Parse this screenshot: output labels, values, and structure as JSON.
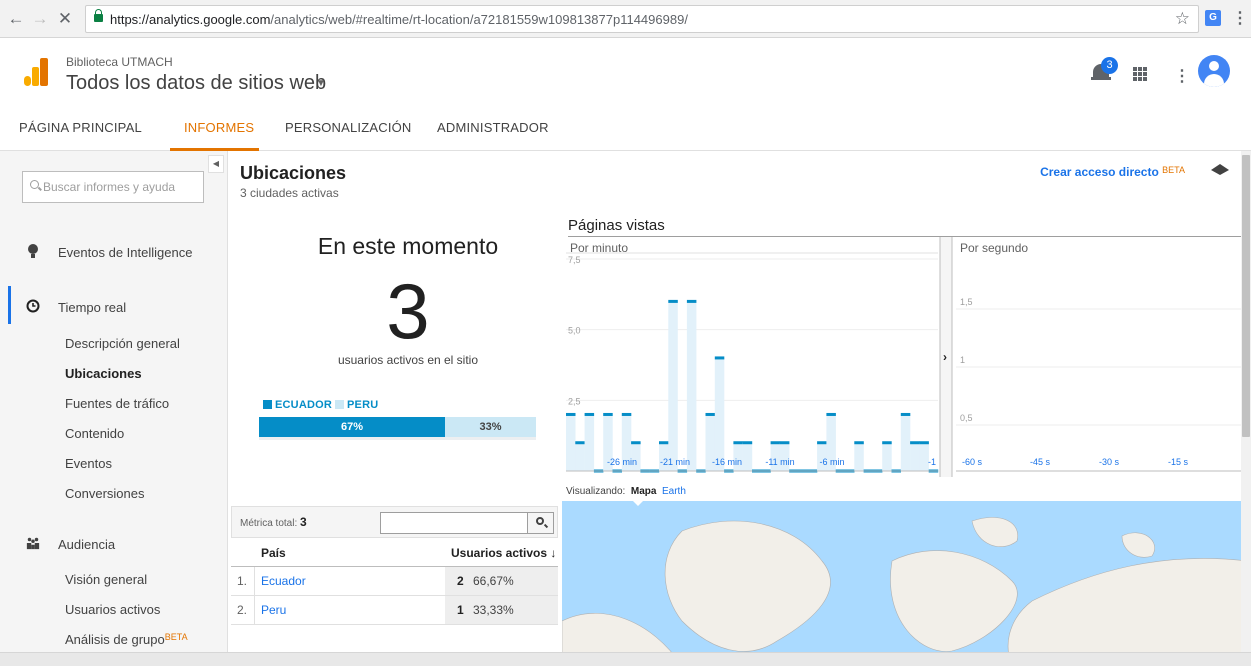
{
  "browser": {
    "url_host": "https://analytics.google.com",
    "url_path": "/analytics/web/#realtime/rt-location/a72181559w109813877p114496989/"
  },
  "header": {
    "account": "Biblioteca UTMACH",
    "property": "Todos los datos de sitios web",
    "notifications_count": "3"
  },
  "tabs": [
    {
      "label": "PÁGINA PRINCIPAL"
    },
    {
      "label": "INFORMES"
    },
    {
      "label": "PERSONALIZACIÓN"
    },
    {
      "label": "ADMINISTRADOR"
    }
  ],
  "sidebar": {
    "search_placeholder": "Buscar informes y ayuda",
    "intelligence": "Eventos de Intelligence",
    "realtime": "Tiempo real",
    "realtime_items": [
      {
        "label": "Descripción general"
      },
      {
        "label": "Ubicaciones"
      },
      {
        "label": "Fuentes de tráfico"
      },
      {
        "label": "Contenido"
      },
      {
        "label": "Eventos"
      },
      {
        "label": "Conversiones"
      }
    ],
    "audience": "Audiencia",
    "audience_items": [
      {
        "label": "Visión general"
      },
      {
        "label": "Usuarios activos"
      },
      {
        "label": "Análisis de grupo"
      }
    ],
    "beta": "BETA"
  },
  "main": {
    "title": "Ubicaciones",
    "subtitle": "3 ciudades activas",
    "shortcut": "Crear acceso directo",
    "shortcut_beta": "BETA",
    "now_label": "En este momento",
    "now_value": "3",
    "now_desc": "usuarios activos en el sitio",
    "split": [
      {
        "name": "ECUADOR",
        "pct": 67,
        "label": "67%",
        "color": "#058dc7"
      },
      {
        "name": "PERU",
        "pct": 33,
        "label": "33%",
        "color": "#cbe8f5"
      }
    ],
    "table": {
      "metric_total_label": "Métrica total:",
      "metric_total_value": "3",
      "col_country": "País",
      "col_users": "Usuarios activos",
      "rows": [
        {
          "idx": "1.",
          "country": "Ecuador",
          "value": "2",
          "pct": "66,67%"
        },
        {
          "idx": "2.",
          "country": "Peru",
          "value": "1",
          "pct": "33,33%"
        }
      ]
    },
    "view_label": "Visualizando:",
    "view_map": "Mapa",
    "view_earth": "Earth"
  },
  "chart_data": [
    {
      "type": "bar",
      "title": "Páginas vistas",
      "subtitle": "Por minuto",
      "yticks": [
        "2,5",
        "5,0",
        "7,5"
      ],
      "ylim": [
        0,
        7.5
      ],
      "xticks": [
        "-26 min",
        "-21 min",
        "-16 min",
        "-11 min",
        "-6 min",
        "-1"
      ],
      "values": [
        2,
        1,
        2,
        0,
        2,
        0,
        2,
        1,
        0,
        0,
        1,
        6,
        0,
        6,
        0,
        2,
        4,
        0,
        1,
        1,
        0,
        0,
        1,
        1,
        0,
        0,
        0,
        1,
        2,
        0,
        0,
        1,
        0,
        0,
        1,
        0,
        2,
        1,
        1,
        0
      ]
    },
    {
      "type": "bar",
      "subtitle": "Por segundo",
      "yticks": [
        "0,5",
        "1",
        "1,5"
      ],
      "xticks": [
        "-60 s",
        "-45 s",
        "-30 s",
        "-15 s"
      ],
      "values": []
    }
  ],
  "colors": {
    "accent": "#e37400",
    "link": "#1a73e8",
    "bar": "#058dc7",
    "bar_fill": "#e2f1fa"
  }
}
